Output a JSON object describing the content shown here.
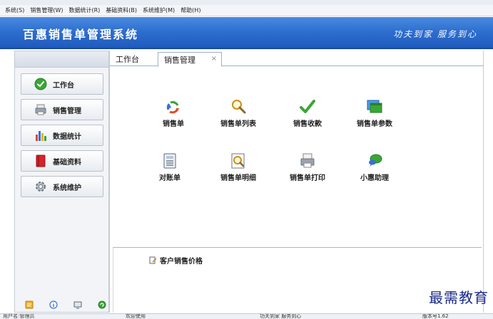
{
  "menubar": {
    "items": [
      "系统(S)",
      "销售管理(W)",
      "数据统计(R)",
      "基础资料(B)",
      "系统维护(M)",
      "帮助(H)"
    ]
  },
  "header": {
    "title": "百惠销售单管理系统",
    "slogan": "功夫到家 服务到心"
  },
  "sidebar": {
    "items": [
      {
        "label": "工作台",
        "icon": "check-circle-icon"
      },
      {
        "label": "销售管理",
        "icon": "printer-icon"
      },
      {
        "label": "数据统计",
        "icon": "bar-chart-icon"
      },
      {
        "label": "基础资料",
        "icon": "book-icon"
      },
      {
        "label": "系统维护",
        "icon": "gear-icon"
      }
    ],
    "footer_icons": [
      "note-icon",
      "info-icon",
      "monitor-icon",
      "refresh-icon"
    ]
  },
  "tabs": {
    "home": "工作台",
    "active": "销售管理",
    "close": "×"
  },
  "functions": {
    "row1": [
      {
        "label": "销售单",
        "icon": "recycle-icon"
      },
      {
        "label": "销售单列表",
        "icon": "magnifier-icon"
      },
      {
        "label": "销售收款",
        "icon": "checkmark-icon"
      },
      {
        "label": "销售单参数",
        "icon": "window-icon"
      }
    ],
    "row2": [
      {
        "label": "对账单",
        "icon": "calculator-icon"
      },
      {
        "label": "销售单明细",
        "icon": "search-document-icon"
      },
      {
        "label": "销售单打印",
        "icon": "printer-icon"
      },
      {
        "label": "小惠助理",
        "icon": "chat-bubble-icon"
      }
    ]
  },
  "price_panel": {
    "title": "客户销售价格"
  },
  "watermark": "最需教育",
  "statusbar": {
    "user": "用户名:管理员",
    "welcome": "欢迎使用",
    "slogan": "功夫到家 服务到心",
    "version": "版本号1.62"
  },
  "colors": {
    "header_blue": "#2f6fd0",
    "accent_green": "#3aa635",
    "watermark_navy": "#1a2a8a"
  }
}
